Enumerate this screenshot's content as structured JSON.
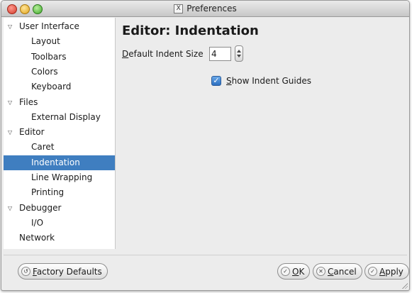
{
  "window": {
    "title": "Preferences"
  },
  "sidebar": {
    "items": [
      {
        "label": "User Interface",
        "kind": "parent",
        "expanded": true
      },
      {
        "label": "Layout",
        "kind": "child"
      },
      {
        "label": "Toolbars",
        "kind": "child"
      },
      {
        "label": "Colors",
        "kind": "child"
      },
      {
        "label": "Keyboard",
        "kind": "child"
      },
      {
        "label": "Files",
        "kind": "parent",
        "expanded": true
      },
      {
        "label": "External Display",
        "kind": "child"
      },
      {
        "label": "Editor",
        "kind": "parent",
        "expanded": true
      },
      {
        "label": "Caret",
        "kind": "child"
      },
      {
        "label": "Indentation",
        "kind": "child",
        "selected": true
      },
      {
        "label": "Line Wrapping",
        "kind": "child"
      },
      {
        "label": "Printing",
        "kind": "child"
      },
      {
        "label": "Debugger",
        "kind": "parent",
        "expanded": true
      },
      {
        "label": "I/O",
        "kind": "child"
      },
      {
        "label": "Network",
        "kind": "leaf"
      }
    ],
    "selected_color": "#3f7ec0"
  },
  "content": {
    "title": "Editor: Indentation",
    "indent_size": {
      "mnemonic": "D",
      "label_rest": "efault Indent Size",
      "value": "4"
    },
    "show_indent_guides": {
      "mnemonic": "S",
      "label_rest": "how Indent Guides",
      "checked": true
    }
  },
  "footer": {
    "factory_defaults": {
      "mnemonic": "F",
      "rest": "actory Defaults"
    },
    "ok": {
      "mnemonic": "O",
      "rest": "K"
    },
    "cancel": {
      "mnemonic": "C",
      "rest": "ancel"
    },
    "apply": {
      "mnemonic": "A",
      "rest": "pply"
    }
  },
  "icons": {
    "checkmark": "✓",
    "reset": "↺",
    "cancel_mark": "✕",
    "expander": "▽",
    "x11": "X"
  }
}
